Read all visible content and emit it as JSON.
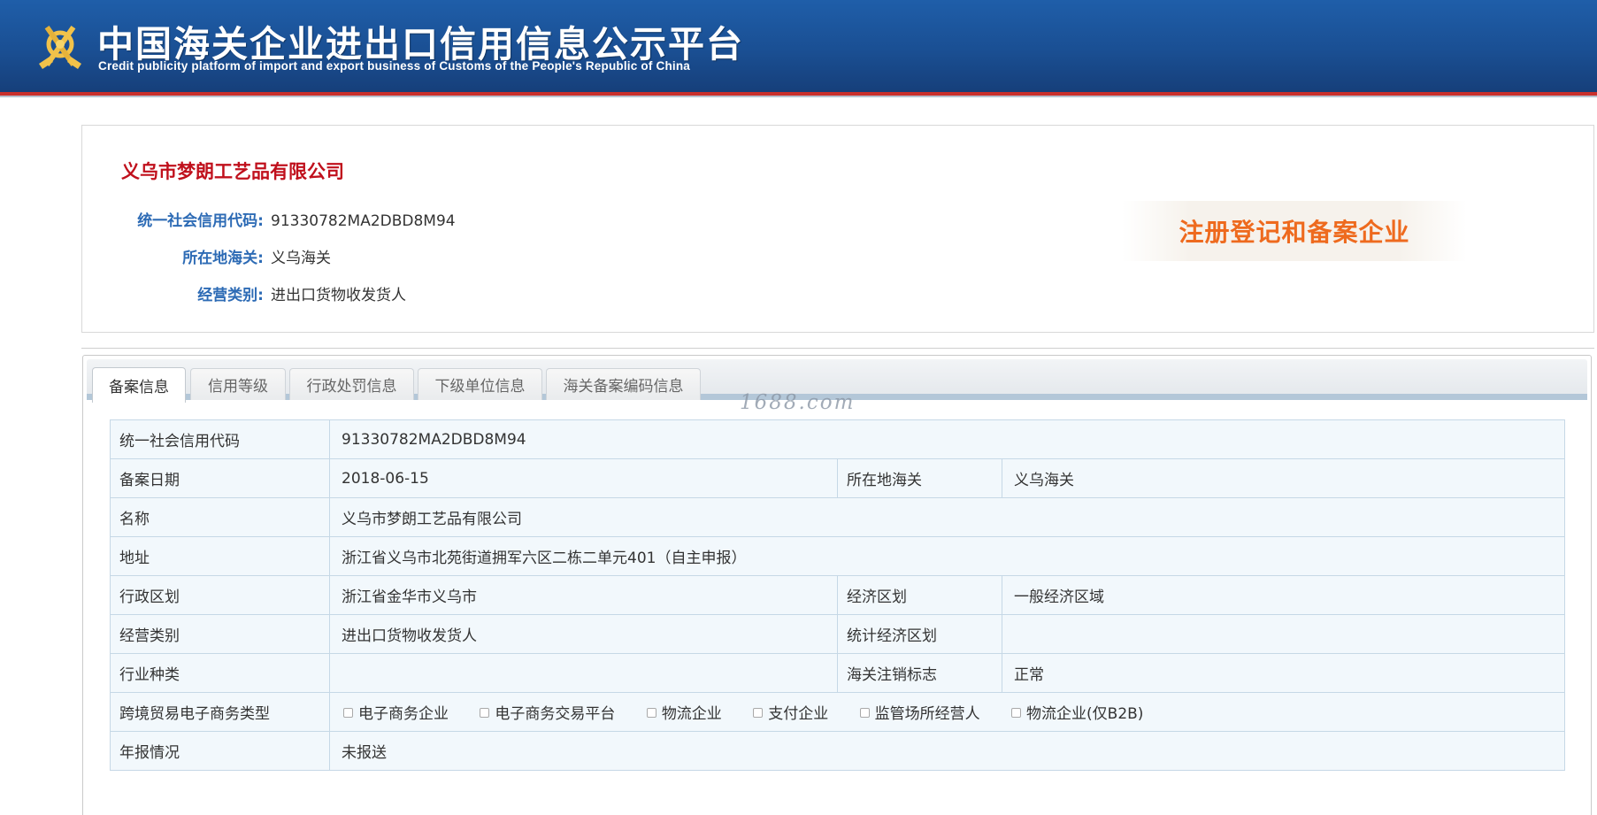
{
  "header": {
    "title": "中国海关企业进出口信用信息公示平台",
    "subtitle": "Credit publicity platform of import and export business of Customs of the People's Republic of China"
  },
  "summary": {
    "company_name": "义乌市梦朗工艺品有限公司",
    "fields": [
      {
        "label": "统一社会信用代码:",
        "value": "91330782MA2DBD8M94"
      },
      {
        "label": "所在地海关:",
        "value": "义乌海关"
      },
      {
        "label": "经营类别:",
        "value": "进出口货物收发货人"
      }
    ],
    "badge": "注册登记和备案企业"
  },
  "tabs": [
    {
      "label": "备案信息",
      "active": true
    },
    {
      "label": "信用等级",
      "active": false
    },
    {
      "label": "行政处罚信息",
      "active": false
    },
    {
      "label": "下级单位信息",
      "active": false
    },
    {
      "label": "海关备案编码信息",
      "active": false
    }
  ],
  "watermark": "1688.com",
  "table": {
    "credit_code_label": "统一社会信用代码",
    "credit_code_value": "91330782MA2DBD8M94",
    "record_date_label": "备案日期",
    "record_date_value": "2018-06-15",
    "customs_label": "所在地海关",
    "customs_value": "义乌海关",
    "name_label": "名称",
    "name_value": "义乌市梦朗工艺品有限公司",
    "address_label": "地址",
    "address_value": "浙江省义乌市北苑街道拥军六区二栋二单元401（自主申报）",
    "admin_region_label": "行政区划",
    "admin_region_value": "浙江省金华市义乌市",
    "econ_region_label": "经济区划",
    "econ_region_value": "一般经济区域",
    "business_type_label": "经营类别",
    "business_type_value": "进出口货物收发货人",
    "stat_econ_region_label": "统计经济区划",
    "stat_econ_region_value": "",
    "industry_label": "行业种类",
    "industry_value": "",
    "cancel_flag_label": "海关注销标志",
    "cancel_flag_value": "正常",
    "ecommerce_label": "跨境贸易电子商务类型",
    "ecommerce_options": [
      {
        "label": "电子商务企业",
        "checked": false
      },
      {
        "label": "电子商务交易平台",
        "checked": false
      },
      {
        "label": "物流企业",
        "checked": false
      },
      {
        "label": "支付企业",
        "checked": false
      },
      {
        "label": "监管场所经营人",
        "checked": false
      },
      {
        "label": "物流企业(仅B2B)",
        "checked": false
      }
    ],
    "annual_report_label": "年报情况",
    "annual_report_value": "未报送"
  },
  "colors": {
    "header_blue": "#1a4f93",
    "company_red": "#c0101c",
    "label_blue": "#2d6bb5",
    "badge_orange": "#ee6a1e",
    "table_bg": "#f2f8fc"
  }
}
